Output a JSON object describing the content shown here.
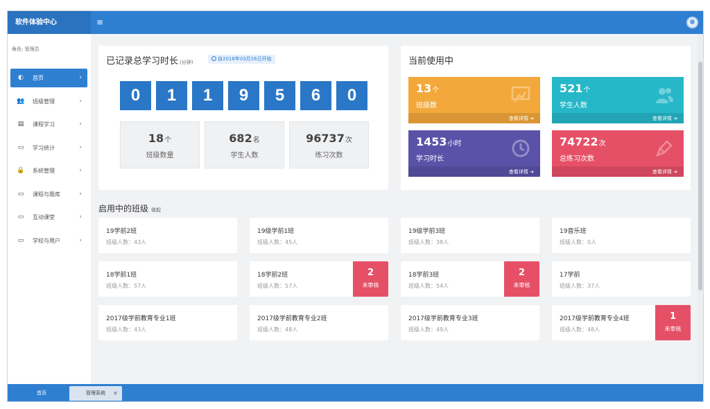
{
  "app": {
    "brand": "软件体验中心",
    "menu_icon": "hamburger-icon",
    "avatar_icon": "user-avatar-icon"
  },
  "sidebar": {
    "role_label": "角色: 管理员",
    "items": [
      {
        "label": "首页",
        "icon": "dashboard-icon",
        "glyph": "◐",
        "arrow": "›"
      },
      {
        "label": "班级管理",
        "icon": "users-icon",
        "glyph": "👥",
        "arrow": "›"
      },
      {
        "label": "课程学习",
        "icon": "book-icon",
        "glyph": "▤",
        "arrow": "›"
      },
      {
        "label": "学习统计",
        "icon": "monitor-icon",
        "glyph": "▭",
        "arrow": "›"
      },
      {
        "label": "系统管理",
        "icon": "lock-icon",
        "glyph": "🔒",
        "arrow": "›"
      },
      {
        "label": "课程与题库",
        "icon": "monitor-icon",
        "glyph": "▭",
        "arrow": "›"
      },
      {
        "label": "互动课堂",
        "icon": "monitor-icon",
        "glyph": "▭",
        "arrow": "›"
      },
      {
        "label": "学校与用户",
        "icon": "monitor-icon",
        "glyph": "▭",
        "arrow": "›"
      }
    ]
  },
  "total": {
    "title": "已记录总学习时长",
    "unit": "(分钟)",
    "since": "自2018年03月16日开始",
    "digits": [
      "0",
      "1",
      "1",
      "9",
      "5",
      "6",
      "0"
    ],
    "stats": [
      {
        "value": "18",
        "unit": "个",
        "label": "班级数量"
      },
      {
        "value": "682",
        "unit": "名",
        "label": "学生人数"
      },
      {
        "value": "96737",
        "unit": "次",
        "label": "练习次数"
      }
    ]
  },
  "current": {
    "title": "当前使用中",
    "metrics": [
      {
        "value": "13",
        "unit": "个",
        "label": "班级数",
        "more": "查看详情 ➔",
        "icon": "classroom-board-icon",
        "color": "#f3a83b"
      },
      {
        "value": "521",
        "unit": "个",
        "label": "学生人数",
        "more": "查看详情 ➔",
        "icon": "users-icon",
        "color": "#26b7c9"
      },
      {
        "value": "1453",
        "unit": "小时",
        "label": "学习时长",
        "more": "查看详情 ➔",
        "icon": "clock-icon",
        "color": "#5a52a8"
      },
      {
        "value": "74722",
        "unit": "次",
        "label": "总练习次数",
        "more": "查看详情 ➔",
        "icon": "pen-icon",
        "color": "#e65067"
      }
    ]
  },
  "classes": {
    "title": "启用中的班级",
    "collapse": "收起",
    "items": [
      {
        "name": "19学前2班",
        "count": "班级人数：43人",
        "pending": null
      },
      {
        "name": "19级学前1班",
        "count": "班级人数：45人",
        "pending": null
      },
      {
        "name": "19级学前3班",
        "count": "班级人数：38人",
        "pending": null
      },
      {
        "name": "19音乐班",
        "count": "班级人数：0人",
        "pending": null
      },
      {
        "name": "18学前1班",
        "count": "班级人数：57人",
        "pending": null
      },
      {
        "name": "18学前2班",
        "count": "班级人数：57人",
        "pending": "2"
      },
      {
        "name": "18学前3班",
        "count": "班级人数：54人",
        "pending": "2"
      },
      {
        "name": "17学前",
        "count": "班级人数：37人",
        "pending": null
      },
      {
        "name": "2017级学前教育专业1班",
        "count": "班级人数：43人",
        "pending": null
      },
      {
        "name": "2017级学前教育专业2班",
        "count": "班级人数：48人",
        "pending": null
      },
      {
        "name": "2017级学前教育专业3班",
        "count": "班级人数：49人",
        "pending": null
      },
      {
        "name": "2017级学前教育专业4班",
        "count": "班级人数：48人",
        "pending": "1"
      }
    ],
    "pending_label": "未审核"
  },
  "bottom_tabs": {
    "home": "首页",
    "admin": "管理系统",
    "close": "✕"
  },
  "colors": {
    "primary": "#2f7fd1",
    "orange": "#f3a83b",
    "teal": "#26b7c9",
    "purple": "#5a52a8",
    "red": "#e65067"
  }
}
